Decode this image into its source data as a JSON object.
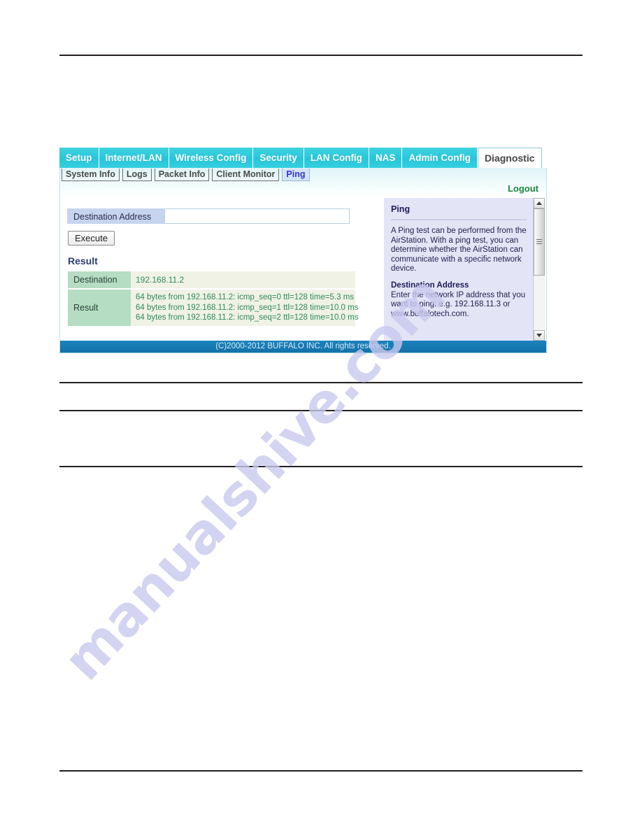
{
  "main_tabs": [
    {
      "label": "Setup",
      "active": false
    },
    {
      "label": "Internet/LAN",
      "active": false
    },
    {
      "label": "Wireless Config",
      "active": false
    },
    {
      "label": "Security",
      "active": false
    },
    {
      "label": "LAN Config",
      "active": false
    },
    {
      "label": "NAS",
      "active": false
    },
    {
      "label": "Admin Config",
      "active": false
    },
    {
      "label": "Diagnostic",
      "active": true
    }
  ],
  "sub_tabs": [
    {
      "label": "System Info",
      "active": false
    },
    {
      "label": "Logs",
      "active": false
    },
    {
      "label": "Packet Info",
      "active": false
    },
    {
      "label": "Client Monitor",
      "active": false
    },
    {
      "label": "Ping",
      "active": true
    }
  ],
  "logout": {
    "label": "Logout"
  },
  "form": {
    "dest_label": "Destination Address",
    "dest_value": "",
    "dest_placeholder": "",
    "execute_label": "Execute"
  },
  "result": {
    "heading": "Result",
    "rows": [
      {
        "label": "Destination",
        "lines": [
          "192.168.11.2"
        ]
      },
      {
        "label": "Result",
        "lines": [
          "64 bytes from 192.168.11.2: icmp_seq=0 ttl=128 time=5.3 ms",
          "64 bytes from 192.168.11.2: icmp_seq=1 ttl=128 time=10.0 ms",
          "64 bytes from 192.168.11.2: icmp_seq=2 ttl=128 time=10.0 ms"
        ]
      }
    ]
  },
  "help": {
    "title": "Ping",
    "paragraph": "A Ping test can be performed from the AirStation. With a ping test, you can determine whether the AirStation can communicate with a specific network device.",
    "subheading": "Destination Address",
    "sub_paragraph": "Enter the network IP address that you want to ping: e.g. 192.168.11.3 or www.buffalotech.com."
  },
  "footer": {
    "copyright": "(C)2000-2012 BUFFALO INC. All rights reserved."
  },
  "watermark": {
    "text": "manualshive.com"
  },
  "colors": {
    "tab_cyan": "#2ec6d9",
    "label_blue": "#c6d4ef",
    "result_head_green": "#b5ddc3",
    "result_value_bg": "#eff2e4",
    "result_text_green": "#2f8a5e",
    "help_bg": "#e4e4f7",
    "footer_blue": "#1472a9",
    "logout_green": "#1a8a3c",
    "active_subtab_blue": "#3333cc"
  }
}
